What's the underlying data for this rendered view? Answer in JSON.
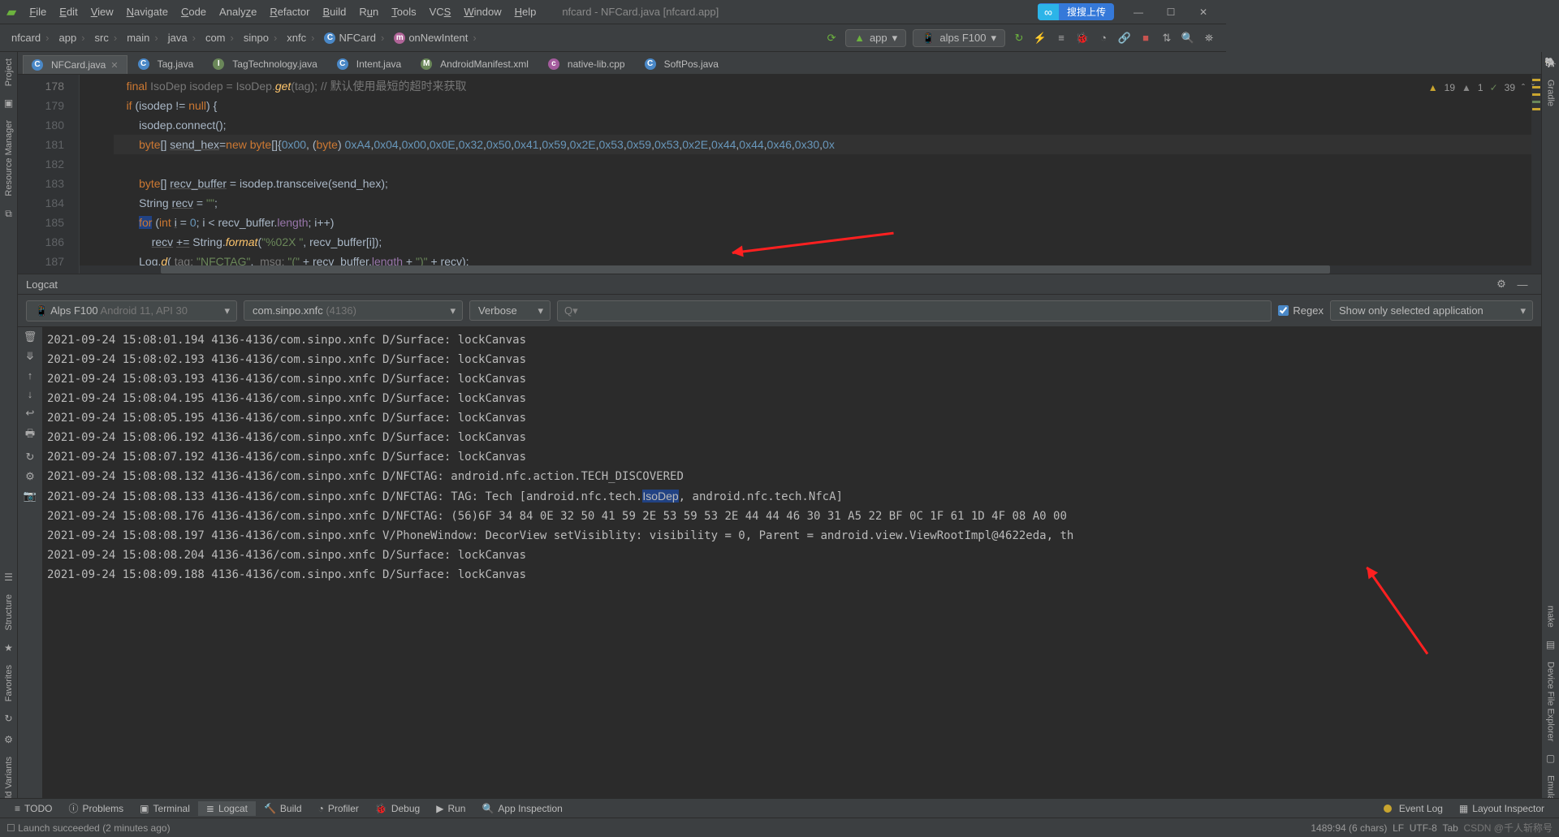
{
  "window": {
    "title": "nfcard - NFCard.java [nfcard.app]"
  },
  "menu": [
    "File",
    "Edit",
    "View",
    "Navigate",
    "Code",
    "Analyze",
    "Refactor",
    "Build",
    "Run",
    "Tools",
    "VCS",
    "Window",
    "Help"
  ],
  "upload_btn": "搜搜上传",
  "breadcrumbs": [
    "nfcard",
    "app",
    "src",
    "main",
    "java",
    "com",
    "sinpo",
    "xnfc"
  ],
  "breadcrumb_class": "NFCard",
  "breadcrumb_method": "onNewIntent",
  "run_config": {
    "module": "app",
    "device": "alps F100"
  },
  "tabs": [
    {
      "name": "NFCard.java",
      "icon": "C",
      "active": true
    },
    {
      "name": "Tag.java",
      "icon": "C",
      "active": false
    },
    {
      "name": "TagTechnology.java",
      "icon": "I",
      "active": false
    },
    {
      "name": "Intent.java",
      "icon": "C",
      "active": false
    },
    {
      "name": "AndroidManifest.xml",
      "icon": "M",
      "active": false
    },
    {
      "name": "native-lib.cpp",
      "icon": "c",
      "active": false
    },
    {
      "name": "SoftPos.java",
      "icon": "C",
      "active": false
    }
  ],
  "editor": {
    "lines": [
      "179",
      "180",
      "181",
      "182",
      "183",
      "184",
      "185",
      "186",
      "187"
    ],
    "warn_count": "19",
    "weak_count": "1",
    "typo_count": "39"
  },
  "left_tools": [
    "Project",
    "Resource Manager",
    "Structure",
    "Favorites",
    "Build Variants"
  ],
  "right_tools": [
    "Gradle",
    "make",
    "Device File Explorer",
    "Emulator"
  ],
  "logcat": {
    "title": "Logcat",
    "device": "Alps F100",
    "device_extra": "Android 11, API 30",
    "process": "com.sinpo.xnfc",
    "process_extra": "(4136)",
    "level": "Verbose",
    "search": "Q▾",
    "regex": "Regex",
    "filter": "Show only selected application",
    "lines": [
      "2021-09-24 15:08:01.194 4136-4136/com.sinpo.xnfc D/Surface: lockCanvas",
      "2021-09-24 15:08:02.193 4136-4136/com.sinpo.xnfc D/Surface: lockCanvas",
      "2021-09-24 15:08:03.193 4136-4136/com.sinpo.xnfc D/Surface: lockCanvas",
      "2021-09-24 15:08:04.195 4136-4136/com.sinpo.xnfc D/Surface: lockCanvas",
      "2021-09-24 15:08:05.195 4136-4136/com.sinpo.xnfc D/Surface: lockCanvas",
      "2021-09-24 15:08:06.192 4136-4136/com.sinpo.xnfc D/Surface: lockCanvas",
      "2021-09-24 15:08:07.192 4136-4136/com.sinpo.xnfc D/Surface: lockCanvas",
      "2021-09-24 15:08:08.132 4136-4136/com.sinpo.xnfc D/NFCTAG: android.nfc.action.TECH_DISCOVERED",
      "2021-09-24 15:08:08.133 4136-4136/com.sinpo.xnfc D/NFCTAG: TAG: Tech [android.nfc.tech.IsoDep, android.nfc.tech.NfcA]",
      "2021-09-24 15:08:08.176 4136-4136/com.sinpo.xnfc D/NFCTAG: (56)6F 34 84 0E 32 50 41 59 2E 53 59 53 2E 44 44 46 30 31 A5 22 BF 0C 1F 61 1D 4F 08 A0 00",
      "2021-09-24 15:08:08.197 4136-4136/com.sinpo.xnfc V/PhoneWindow: DecorView setVisiblity: visibility = 0, Parent = android.view.ViewRootImpl@4622eda, th",
      "2021-09-24 15:08:08.204 4136-4136/com.sinpo.xnfc D/Surface: lockCanvas",
      "2021-09-24 15:08:09.188 4136-4136/com.sinpo.xnfc D/Surface: lockCanvas"
    ]
  },
  "bottom_tabs": [
    "TODO",
    "Problems",
    "Terminal",
    "Logcat",
    "Build",
    "Profiler",
    "Debug",
    "Run",
    "App Inspection"
  ],
  "bottom_right": {
    "event_log": "Event Log",
    "layout_inspector": "Layout Inspector"
  },
  "status": {
    "msg": "Launch succeeded (2 minutes ago)",
    "pos": "1489:94 (6 chars)",
    "enc": "LF",
    "charset": "UTF-8",
    "tab": "Tab",
    "watermark": "CSDN @千人斩称号"
  }
}
